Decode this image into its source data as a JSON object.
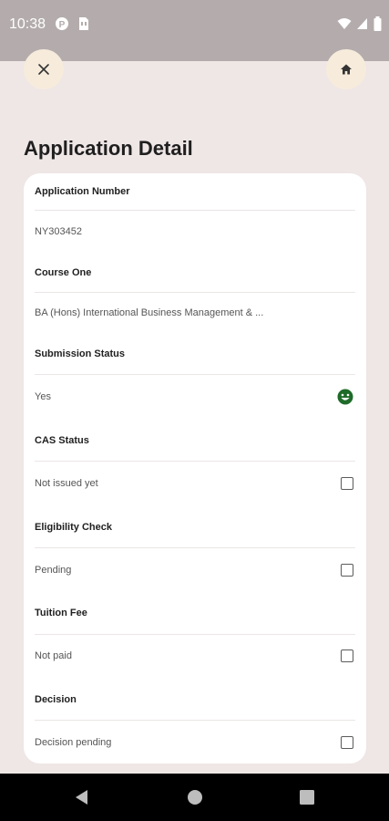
{
  "status_bar": {
    "time": "10:38",
    "left_icons": [
      "hotspot-icon",
      "sim-icon"
    ],
    "right_icons": [
      "wifi-icon",
      "signal-icon",
      "battery-icon"
    ]
  },
  "top_actions": {
    "close_icon": "close-icon",
    "home_icon": "home-icon",
    "button_color": "#f7ecdc"
  },
  "page": {
    "title": "Application Detail",
    "background": "#efe6e6"
  },
  "details": [
    {
      "label": "Application Number",
      "value": "NY303452",
      "indicator": "none"
    },
    {
      "label": "Course One",
      "value": "BA (Hons) International Business Management  & ...",
      "indicator": "none"
    },
    {
      "label": "Submission Status",
      "value": "Yes",
      "indicator": "smile-icon",
      "indicator_color": "#1f6b2a"
    },
    {
      "label": "CAS Status",
      "value": "Not issued yet",
      "indicator": "checkbox-unchecked"
    },
    {
      "label": "Eligibility Check",
      "value": "Pending",
      "indicator": "checkbox-unchecked"
    },
    {
      "label": "Tuition Fee",
      "value": "Not paid",
      "indicator": "checkbox-unchecked"
    },
    {
      "label": "Decision",
      "value": "Decision pending",
      "indicator": "checkbox-unchecked"
    }
  ],
  "nav_bar": {
    "items": [
      "back-icon",
      "home-circle-icon",
      "recents-icon"
    ]
  }
}
